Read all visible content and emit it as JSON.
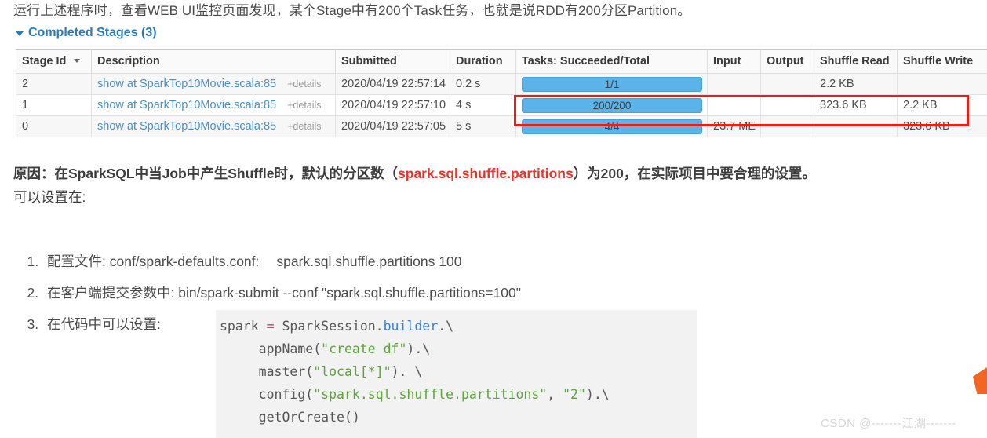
{
  "intro": {
    "text": "运行上述程序时，查看WEB UI监控页面发现，某个Stage中有200个Task任务，也就是说RDD有200分区Partition。"
  },
  "stages_section": {
    "heading": "Completed Stages (3)",
    "caret_icon": "triangle-down-icon"
  },
  "table": {
    "columns": [
      "Stage Id",
      "Description",
      "Submitted",
      "Duration",
      "Tasks: Succeeded/Total",
      "Input",
      "Output",
      "Shuffle Read",
      "Shuffle Write"
    ],
    "sort_icon": "sort-descending-icon",
    "details_label": "+details",
    "rows": [
      {
        "stage_id": "2",
        "description": "show at SparkTop10Movie.scala:85",
        "details": "+details",
        "submitted": "2020/04/19 22:57:14",
        "duration": "0.2 s",
        "tasks": "1/1",
        "tasks_pct": 100,
        "input": "",
        "output": "",
        "shuffle_read": "2.2 KB",
        "shuffle_write": ""
      },
      {
        "stage_id": "1",
        "description": "show at SparkTop10Movie.scala:85",
        "details": "+details",
        "submitted": "2020/04/19 22:57:10",
        "duration": "4 s",
        "tasks": "200/200",
        "tasks_pct": 100,
        "input": "",
        "output": "",
        "shuffle_read": "323.6 KB",
        "shuffle_write": "2.2 KB"
      },
      {
        "stage_id": "0",
        "description": "show at SparkTop10Movie.scala:85",
        "details": "+details",
        "submitted": "2020/04/19 22:57:05",
        "duration": "5 s",
        "tasks": "4/4",
        "tasks_pct": 100,
        "input": "23.7 ME",
        "output": "",
        "shuffle_read": "",
        "shuffle_write": "323.6 KB"
      }
    ],
    "highlight_color": "#ee1c16",
    "progress_color": "#5cb3ea"
  },
  "reason": {
    "prefix": "原因：",
    "body_1": "在SparkSQL中当Job中产生Shuffle时，默认的分区数（",
    "highlight": "spark.sql.shuffle.partitions",
    "body_2": "）为200，在实际项目中要合理的设置。",
    "line_2": "可以设置在:",
    "highlight_color": "#e8352c"
  },
  "settings_list": [
    {
      "label": "配置文件: conf/spark-defaults.conf:",
      "value": "spark.sql.shuffle.partitions 100"
    },
    {
      "label": "在客户端提交参数中: bin/spark-submit --conf \"spark.sql.shuffle.partitions=100\"",
      "value": ""
    },
    {
      "label": "在代码中可以设置:",
      "value": ""
    }
  ],
  "code_block": {
    "lines": [
      [
        {
          "t": "spark ",
          "c": "plain"
        },
        {
          "t": "=",
          "c": "op"
        },
        {
          "t": " SparkSession.",
          "c": "plain"
        },
        {
          "t": "builder",
          "c": "attr"
        },
        {
          "t": ".\\",
          "c": "plain"
        }
      ],
      [
        {
          "t": "     appName(",
          "c": "plain"
        },
        {
          "t": "\"create df\"",
          "c": "str"
        },
        {
          "t": ").\\",
          "c": "plain"
        }
      ],
      [
        {
          "t": "     master(",
          "c": "plain"
        },
        {
          "t": "\"local[*]\"",
          "c": "str"
        },
        {
          "t": "). \\",
          "c": "plain"
        }
      ],
      [
        {
          "t": "     config(",
          "c": "plain"
        },
        {
          "t": "\"spark.sql.shuffle.partitions\"",
          "c": "str"
        },
        {
          "t": ", ",
          "c": "plain"
        },
        {
          "t": "\"2\"",
          "c": "str"
        },
        {
          "t": ").\\",
          "c": "plain"
        }
      ],
      [
        {
          "t": "     getOrCreate()",
          "c": "plain"
        }
      ]
    ]
  },
  "watermark": {
    "text": "CSDN @-------江湖-------"
  }
}
